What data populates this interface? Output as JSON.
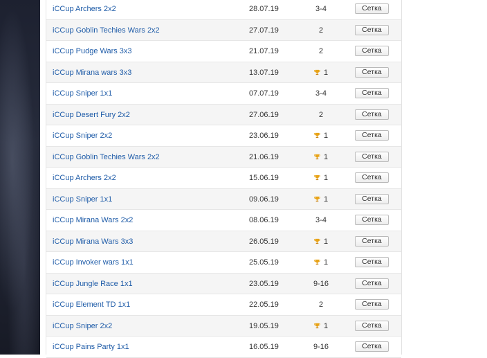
{
  "tournaments": [
    {
      "name": "iCCup Archers 2x2",
      "date": "28.07.19",
      "place": "3-4",
      "trophy": false,
      "button": "Сетка"
    },
    {
      "name": "iCCup Goblin Techies Wars 2x2",
      "date": "27.07.19",
      "place": "2",
      "trophy": false,
      "button": "Сетка"
    },
    {
      "name": "iCCup Pudge Wars 3x3",
      "date": "21.07.19",
      "place": "2",
      "trophy": false,
      "button": "Сетка"
    },
    {
      "name": "iCCup Mirana wars 3x3",
      "date": "13.07.19",
      "place": "1",
      "trophy": true,
      "button": "Сетка"
    },
    {
      "name": "iCCup Sniper 1x1",
      "date": "07.07.19",
      "place": "3-4",
      "trophy": false,
      "button": "Сетка"
    },
    {
      "name": "iCCup Desert Fury 2x2",
      "date": "27.06.19",
      "place": "2",
      "trophy": false,
      "button": "Сетка"
    },
    {
      "name": "iCCup Sniper 2x2",
      "date": "23.06.19",
      "place": "1",
      "trophy": true,
      "button": "Сетка"
    },
    {
      "name": "iCCup Goblin Techies Wars 2x2",
      "date": "21.06.19",
      "place": "1",
      "trophy": true,
      "button": "Сетка"
    },
    {
      "name": "iCCup Archers 2x2",
      "date": "15.06.19",
      "place": "1",
      "trophy": true,
      "button": "Сетка"
    },
    {
      "name": "iCCup Sniper 1x1",
      "date": "09.06.19",
      "place": "1",
      "trophy": true,
      "button": "Сетка"
    },
    {
      "name": "iCCup Mirana Wars 2x2",
      "date": "08.06.19",
      "place": "3-4",
      "trophy": false,
      "button": "Сетка"
    },
    {
      "name": "iCCup Mirana Wars 3x3",
      "date": "26.05.19",
      "place": "1",
      "trophy": true,
      "button": "Сетка"
    },
    {
      "name": "iCCup Invoker wars 1x1",
      "date": "25.05.19",
      "place": "1",
      "trophy": true,
      "button": "Сетка"
    },
    {
      "name": "iCCup Jungle Race 1x1",
      "date": "23.05.19",
      "place": "9-16",
      "trophy": false,
      "button": "Сетка"
    },
    {
      "name": "iCCup Element TD 1x1",
      "date": "22.05.19",
      "place": "2",
      "trophy": false,
      "button": "Сетка"
    },
    {
      "name": "iCCup Sniper 2x2",
      "date": "19.05.19",
      "place": "1",
      "trophy": true,
      "button": "Сетка"
    },
    {
      "name": "iCCup Pains Party 1x1",
      "date": "16.05.19",
      "place": "9-16",
      "trophy": false,
      "button": "Сетка"
    }
  ],
  "colors": {
    "link": "#1f5ca8",
    "trophy": "#e8a317",
    "row_alt": "#f5f5f5"
  },
  "icons": {
    "trophy": "trophy-icon"
  }
}
